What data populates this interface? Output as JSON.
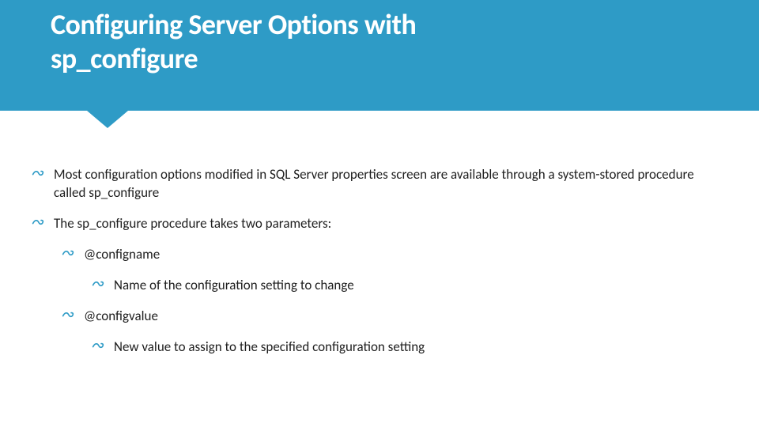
{
  "header": {
    "title_line1": "Configuring Server Options with",
    "title_line2": "sp_configure"
  },
  "bullets": [
    {
      "level": 1,
      "text": "Most configuration options modified in SQL Server properties screen are available through a system-stored procedure called sp_configure"
    },
    {
      "level": 1,
      "text": "The sp_configure procedure takes two parameters:"
    },
    {
      "level": 2,
      "text": "@configname"
    },
    {
      "level": 3,
      "text": "Name of the configuration setting to change"
    },
    {
      "level": 2,
      "text": "@configvalue"
    },
    {
      "level": 3,
      "text": "New value to assign to the specified configuration setting"
    }
  ],
  "colors": {
    "accent": "#2e9bc6"
  }
}
